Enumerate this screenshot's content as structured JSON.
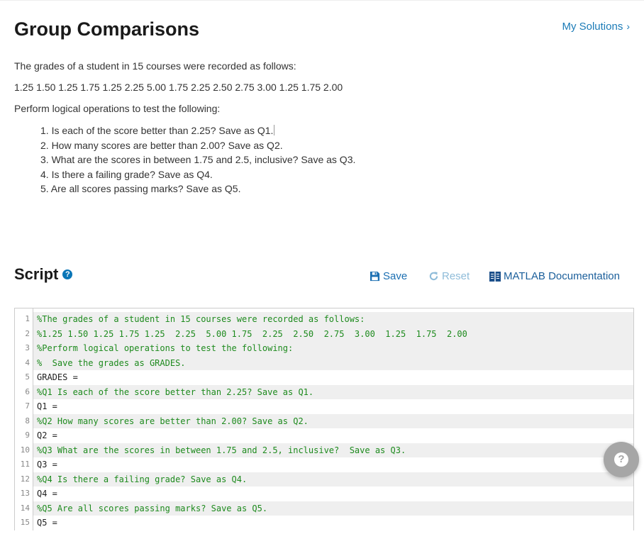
{
  "header": {
    "title": "Group Comparisons",
    "my_solutions_label": "My Solutions",
    "my_solutions_chevron": "›"
  },
  "problem": {
    "intro": "The grades of a student in 15 courses were recorded as follows:",
    "grades": "1.25 1.50 1.25 1.75 1.25  2.25  5.00 1.75  2.25  2.50  2.75  3.00  1.25  1.75  2.00",
    "instruction": "Perform logical operations to test the following:",
    "questions": [
      "1. Is each of the score better than 2.25? Save as Q1.",
      "2. How many scores are better than 2.00? Save as Q2.",
      "3. What are the scores in between 1.75 and 2.5, inclusive?  Save as Q3.",
      "4. Is there a failing grade? Save as Q4.",
      "5. Are all scores passing marks? Save as Q5."
    ]
  },
  "script": {
    "title": "Script",
    "help_icon": "?",
    "toolbar": {
      "save_label": "Save",
      "reset_label": "Reset",
      "doc_label": "MATLAB Documentation"
    },
    "lines": [
      {
        "n": "1",
        "text": "%The grades of a student in 15 courses were recorded as follows:",
        "type": "comment"
      },
      {
        "n": "2",
        "text": "%1.25 1.50 1.25 1.75 1.25  2.25  5.00 1.75  2.25  2.50  2.75  3.00  1.25  1.75  2.00",
        "type": "comment"
      },
      {
        "n": "3",
        "text": "%Perform logical operations to test the following:",
        "type": "comment"
      },
      {
        "n": "4",
        "text": "%  Save the grades as GRADES.",
        "type": "comment"
      },
      {
        "n": "5",
        "text": "GRADES =",
        "type": "plain"
      },
      {
        "n": "6",
        "text": "%Q1 Is each of the score better than 2.25? Save as Q1.",
        "type": "comment"
      },
      {
        "n": "7",
        "text": "Q1 =",
        "type": "plain"
      },
      {
        "n": "8",
        "text": "%Q2 How many scores are better than 2.00? Save as Q2.",
        "type": "comment"
      },
      {
        "n": "9",
        "text": "Q2 =",
        "type": "plain"
      },
      {
        "n": "10",
        "text": "%Q3 What are the scores in between 1.75 and 2.5, inclusive?  Save as Q3.",
        "type": "comment"
      },
      {
        "n": "11",
        "text": "Q3 =",
        "type": "plain"
      },
      {
        "n": "12",
        "text": "%Q4 Is there a failing grade? Save as Q4.",
        "type": "comment"
      },
      {
        "n": "13",
        "text": "Q4 =",
        "type": "plain"
      },
      {
        "n": "14",
        "text": "%Q5 Are all scores passing marks? Save as Q5.",
        "type": "comment"
      },
      {
        "n": "15",
        "text": "Q5 =",
        "type": "plain"
      }
    ]
  },
  "help_fab": {
    "icon": "?"
  },
  "colors": {
    "link": "#1b7bb7",
    "comment": "#1d8a1d",
    "reset_disabled": "#8fbcd9",
    "fab": "#a6a6a6"
  }
}
